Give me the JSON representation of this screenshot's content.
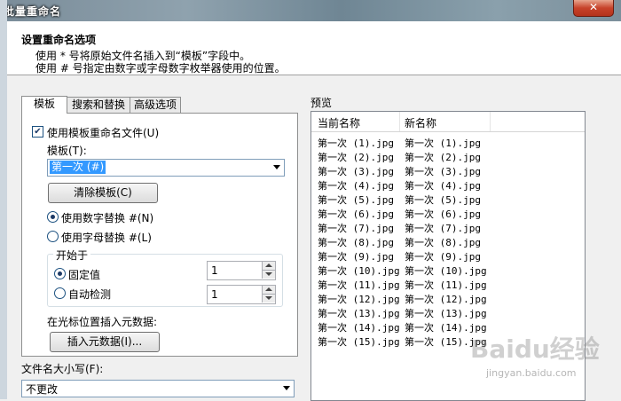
{
  "window": {
    "title": "批量重命名",
    "close": "✕"
  },
  "header": {
    "title": "设置重命名选项",
    "line1": "使用 * 号将原始文件名插入到“模板”字段中。",
    "line2": "使用 # 号指定由数字或字母数字枚举器使用的位置。"
  },
  "tabs": [
    "模板",
    "搜索和替换",
    "高级选项"
  ],
  "template_panel": {
    "use_template_label": "使用模板重命名文件(U)",
    "use_template_checked": true,
    "template_label": "模板(T):",
    "template_value": "第一次 (#)",
    "clear_button": "清除模板(C)",
    "radio_numeric": "使用数字替换 #(N)",
    "radio_alpha": "使用字母替换 #(L)",
    "start_group": "开始于",
    "fixed_label": "固定值",
    "fixed_value": "1",
    "auto_label": "自动检测",
    "auto_value": "1",
    "insert_meta_label": "在光标位置插入元数据:",
    "insert_meta_button": "插入元数据(I)..."
  },
  "case": {
    "label": "文件名大小写(F):",
    "value": "不更改"
  },
  "preview": {
    "label": "预览",
    "col_current": "当前名称",
    "col_new": "新名称",
    "rows": [
      [
        "第一次 (1).jpg",
        "第一次 (1).jpg"
      ],
      [
        "第一次 (2).jpg",
        "第一次 (2).jpg"
      ],
      [
        "第一次 (3).jpg",
        "第一次 (3).jpg"
      ],
      [
        "第一次 (4).jpg",
        "第一次 (4).jpg"
      ],
      [
        "第一次 (5).jpg",
        "第一次 (5).jpg"
      ],
      [
        "第一次 (6).jpg",
        "第一次 (6).jpg"
      ],
      [
        "第一次 (7).jpg",
        "第一次 (7).jpg"
      ],
      [
        "第一次 (8).jpg",
        "第一次 (8).jpg"
      ],
      [
        "第一次 (9).jpg",
        "第一次 (9).jpg"
      ],
      [
        "第一次 (10).jpg",
        "第一次 (10).jpg"
      ],
      [
        "第一次 (11).jpg",
        "第一次 (11).jpg"
      ],
      [
        "第一次 (12).jpg",
        "第一次 (12).jpg"
      ],
      [
        "第一次 (13).jpg",
        "第一次 (13).jpg"
      ],
      [
        "第一次 (14).jpg",
        "第一次 (14).jpg"
      ],
      [
        "第一次 (15).jpg",
        "第一次 (15).jpg"
      ]
    ]
  },
  "watermark": {
    "text": "Baidu经验",
    "url": "jingyan.baidu.com"
  }
}
